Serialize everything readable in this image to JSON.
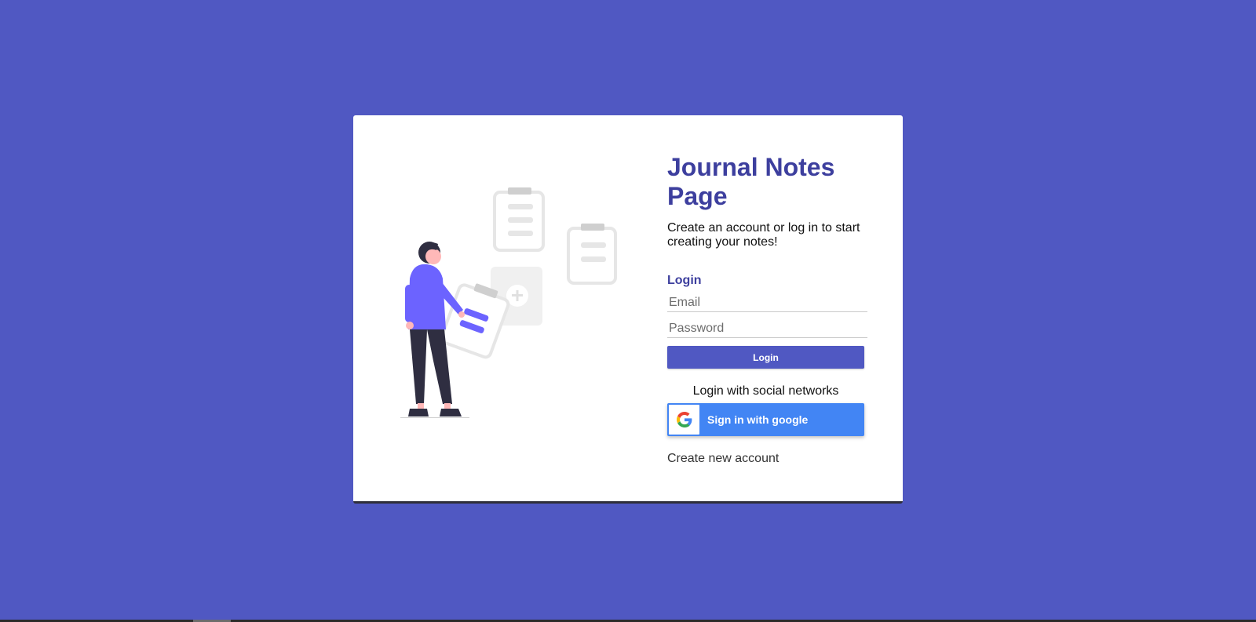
{
  "colors": {
    "background": "#5058c2",
    "accent": "#3d3f9e",
    "button": "#5058c2",
    "google": "#4285f4",
    "illustration_accent": "#6c63ff"
  },
  "header": {
    "title": "Journal Notes Page",
    "subtitle": "Create an account or log in to start creating your notes!"
  },
  "login_form": {
    "section_label": "Login",
    "email_placeholder": "Email",
    "password_placeholder": "Password",
    "submit_label": "Login"
  },
  "social": {
    "label": "Login with social networks",
    "google_button_label": "Sign in with google",
    "google_icon": "google-g-icon"
  },
  "footer": {
    "create_account_label": "Create new account"
  },
  "illustration": {
    "icon": "person-with-notes-illustration"
  }
}
